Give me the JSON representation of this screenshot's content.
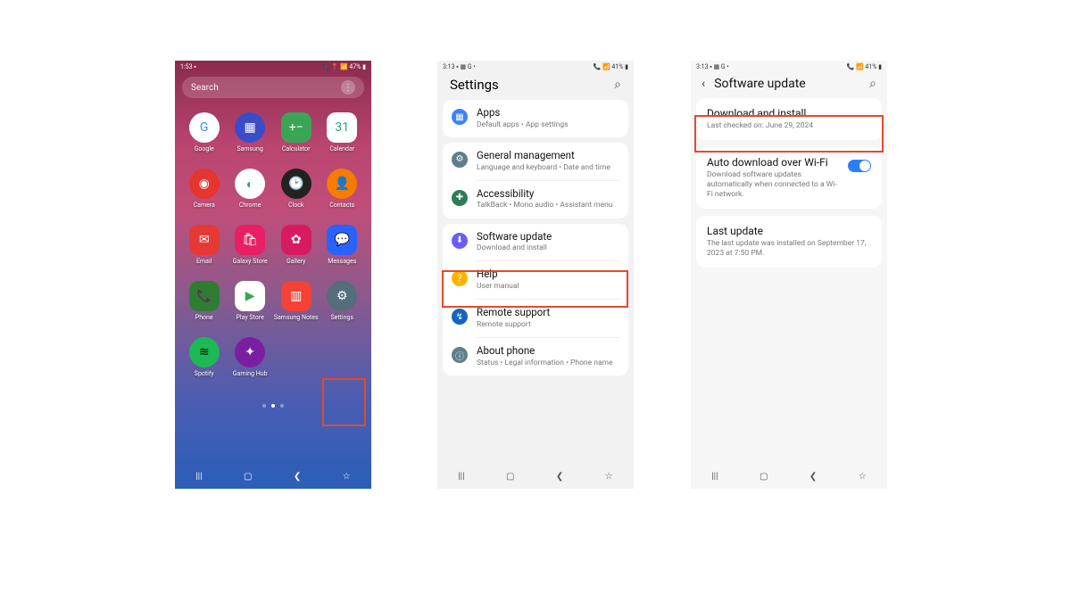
{
  "phone1": {
    "status_left": "1:53  ▪",
    "status_right": "📞📍  📶 47% ▮",
    "search_placeholder": "Search",
    "apps": [
      {
        "label": "Google",
        "bg": "#fff",
        "circle": true,
        "glyph": "G",
        "gc": "#4285f4"
      },
      {
        "label": "Samsung",
        "bg": "#3b4cca",
        "circle": true,
        "glyph": "▦",
        "gc": "#fff"
      },
      {
        "label": "Calculator",
        "bg": "#3aa655",
        "circle": false,
        "glyph": "+−",
        "gc": "#fff"
      },
      {
        "label": "Calendar",
        "bg": "#fff",
        "circle": false,
        "glyph": "31",
        "gc": "#2a7"
      },
      {
        "label": "Camera",
        "bg": "#e6342e",
        "circle": true,
        "glyph": "◉",
        "gc": "#fff"
      },
      {
        "label": "Chrome",
        "bg": "#fff",
        "circle": true,
        "glyph": "◐",
        "gc": "#2a7"
      },
      {
        "label": "Clock",
        "bg": "#222",
        "circle": true,
        "glyph": "🕑",
        "gc": "#fff"
      },
      {
        "label": "Contacts",
        "bg": "#f57c00",
        "circle": true,
        "glyph": "👤",
        "gc": "#fff"
      },
      {
        "label": "Email",
        "bg": "#e53935",
        "circle": false,
        "glyph": "✉",
        "gc": "#fff"
      },
      {
        "label": "Galaxy Store",
        "bg": "#e91e63",
        "circle": false,
        "glyph": "🛍",
        "gc": "#fff"
      },
      {
        "label": "Gallery",
        "bg": "#d81b60",
        "circle": false,
        "glyph": "✿",
        "gc": "#fff"
      },
      {
        "label": "Messages",
        "bg": "#2962ff",
        "circle": false,
        "glyph": "💬",
        "gc": "#fff"
      },
      {
        "label": "Phone",
        "bg": "#2e7d32",
        "circle": false,
        "glyph": "📞",
        "gc": "#fff"
      },
      {
        "label": "Play Store",
        "bg": "#fff",
        "circle": false,
        "glyph": "▶",
        "gc": "#34a853"
      },
      {
        "label": "Samsung Notes",
        "bg": "#f44336",
        "circle": false,
        "glyph": "▥",
        "gc": "#fff"
      },
      {
        "label": "Settings",
        "bg": "#546e7a",
        "circle": true,
        "glyph": "⚙",
        "gc": "#fff"
      },
      {
        "label": "Spotify",
        "bg": "#1db954",
        "circle": true,
        "glyph": "≋",
        "gc": "#000"
      },
      {
        "label": "Gaming Hub",
        "bg": "#7b1fa2",
        "circle": true,
        "glyph": "✦",
        "gc": "#fff"
      }
    ]
  },
  "phone2": {
    "status_left": "3:13  ▪ ▦ G •",
    "status_right": "📞  📶 41% ▮",
    "title": "Settings",
    "items": [
      {
        "icon_bg": "#3b82f6",
        "glyph": "▦",
        "title": "Apps",
        "sub": "Default apps • App settings"
      },
      {
        "icon_bg": "#607d8b",
        "glyph": "⚙",
        "title": "General management",
        "sub": "Language and keyboard • Date and time"
      },
      {
        "icon_bg": "#2e7d57",
        "glyph": "✚",
        "title": "Accessibility",
        "sub": "TalkBack • Mono audio • Assistant menu"
      },
      {
        "icon_bg": "#6b5ef0",
        "glyph": "⬇",
        "title": "Software update",
        "sub": "Download and install"
      },
      {
        "icon_bg": "#ffb300",
        "glyph": "?",
        "title": "Help",
        "sub": "User manual"
      },
      {
        "icon_bg": "#1565c0",
        "glyph": "↯",
        "title": "Remote support",
        "sub": "Remote support"
      },
      {
        "icon_bg": "#607d8b",
        "glyph": "ⓘ",
        "title": "About phone",
        "sub": "Status • Legal information • Phone name"
      }
    ]
  },
  "phone3": {
    "status_left": "3:13  ▪ ▦ G •",
    "status_right": "📞  📶 41% ▮",
    "title": "Software update",
    "card1_title": "Download and install",
    "card1_sub": "Last checked on: June 29, 2024",
    "card2_title": "Auto download over Wi-Fi",
    "card2_sub": "Download software updates automatically when connected to a Wi-Fi network.",
    "card3_title": "Last update",
    "card3_sub": "The last update was installed on September 17, 2023 at 7:50 PM."
  }
}
